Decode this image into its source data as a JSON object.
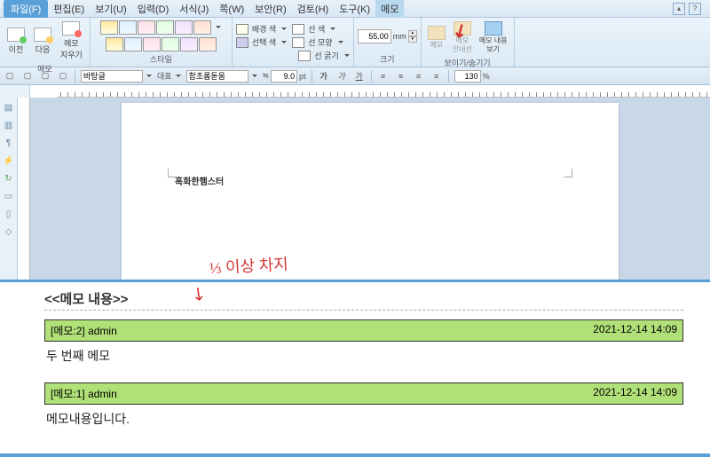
{
  "menus": {
    "file": "파일(F)",
    "items": [
      "편집(E)",
      "보기(U)",
      "입력(D)",
      "서식(J)",
      "쪽(W)",
      "보안(R)",
      "검토(H)",
      "도구(K)"
    ],
    "memo": "메모"
  },
  "ribbon": {
    "group_memo": "메모",
    "memo_prev": "이전",
    "memo_next": "다음",
    "memo_erase": "메모\n지우기",
    "group_style": "스타일",
    "group_props": {
      "bg_color": "배경 색",
      "select_color": "선택 색",
      "line_color": "선 색",
      "line_shape": "선 모양",
      "line_thick": "선 굵기"
    },
    "group_size": "크기",
    "size_value": "55.00",
    "size_unit": "mm",
    "group_show": "보이기/숨기기",
    "show_memo": "메모",
    "show_guide": "메모\n안내선",
    "show_content": "메모 내용\n보기"
  },
  "subtoolbar": {
    "font_style": "바탕글",
    "rep": "대표",
    "font_name": "함초롬돋움",
    "size_pref": "≒",
    "size_val": "9.0",
    "size_unit": "pt",
    "zoom_val": "130",
    "zoom_unit": "%"
  },
  "document": {
    "text": "흑화한햄스터"
  },
  "annotation": {
    "text": "⅓ 이상 차지"
  },
  "memo_panel": {
    "title": "<<메모 내용>>",
    "items": [
      {
        "label": "[메모:2] admin",
        "timestamp": "2021-12-14 14:09",
        "body": "두 번째 메모"
      },
      {
        "label": "[메모:1] admin",
        "timestamp": "2021-12-14 14:09",
        "body": "메모내용입니다."
      }
    ]
  }
}
